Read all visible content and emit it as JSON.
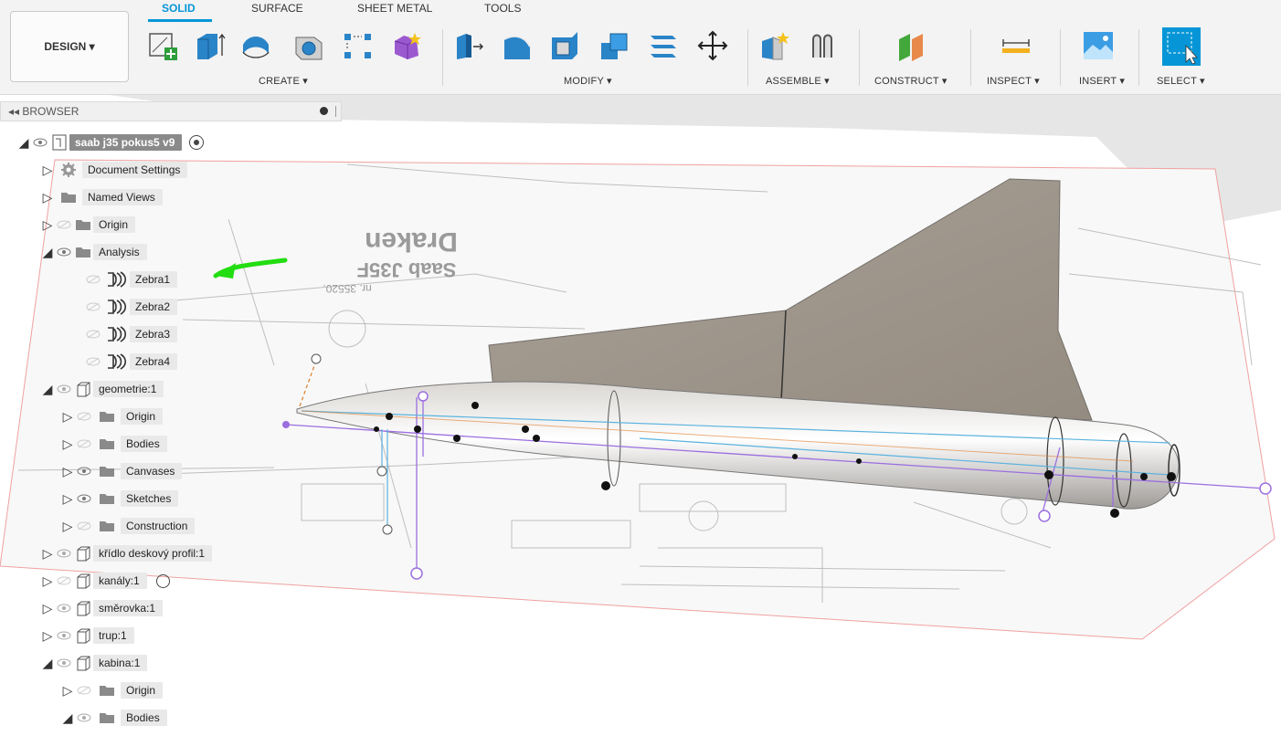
{
  "tabs": [
    {
      "label": "SOLID",
      "active": true
    },
    {
      "label": "SURFACE",
      "active": false
    },
    {
      "label": "SHEET METAL",
      "active": false
    },
    {
      "label": "TOOLS",
      "active": false
    }
  ],
  "workspace": {
    "label": "DESIGN ▾"
  },
  "groups": {
    "create": "CREATE ▾",
    "modify": "MODIFY ▾",
    "assemble": "ASSEMBLE ▾",
    "construct": "CONSTRUCT ▾",
    "inspect": "INSPECT ▾",
    "insert": "INSERT ▾",
    "select": "SELECT ▾"
  },
  "browser": {
    "title": "◂◂ BROWSER",
    "root": "saab j35 pokus5 v9",
    "items": [
      {
        "label": "Document Settings"
      },
      {
        "label": "Named Views"
      },
      {
        "label": "Origin"
      },
      {
        "label": "Analysis"
      },
      {
        "label": "Zebra1"
      },
      {
        "label": "Zebra2"
      },
      {
        "label": "Zebra3"
      },
      {
        "label": "Zebra4"
      },
      {
        "label": "geometrie:1"
      },
      {
        "label": "Origin"
      },
      {
        "label": "Bodies"
      },
      {
        "label": "Canvases"
      },
      {
        "label": "Sketches"
      },
      {
        "label": "Construction"
      },
      {
        "label": "křídlo deskový profil:1"
      },
      {
        "label": "kanály:1"
      },
      {
        "label": "směrovka:1"
      },
      {
        "label": "trup:1"
      },
      {
        "label": "kabina:1"
      },
      {
        "label": "Origin"
      },
      {
        "label": "Bodies"
      }
    ]
  },
  "canvas_text": {
    "title": "Saab J35F",
    "subtitle": "Draken",
    "ref": "nr. 35520."
  },
  "colors": {
    "accent": "#0696d7",
    "annotation": "#22dd11",
    "sketch": "#9b6fe0"
  }
}
